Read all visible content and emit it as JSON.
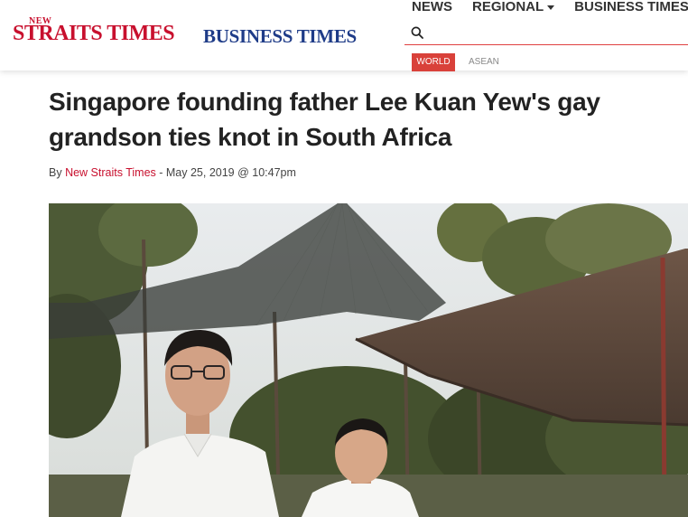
{
  "header": {
    "logo_new": "NEW",
    "logo_main": "STRAITS TIMES",
    "logo_business": "BUSINESS TIMES",
    "nav": [
      {
        "label": "NEWS",
        "has_dropdown": false
      },
      {
        "label": "REGIONAL",
        "has_dropdown": true
      },
      {
        "label": "BUSINESS TIMES",
        "has_dropdown": false
      }
    ],
    "search": {
      "value": "",
      "placeholder": "",
      "icon": "search-icon"
    },
    "tabs": [
      {
        "label": "WORLD",
        "active": true
      },
      {
        "label": "ASEAN",
        "active": false
      }
    ]
  },
  "article": {
    "headline": "Singapore founding father Lee Kuan Yew's gay grandson ties knot in South Africa",
    "byline": {
      "prefix": "By ",
      "author": "New Straits Times",
      "date": " - May 25, 2019 @ 10:47pm"
    }
  },
  "colors": {
    "brand_red": "#c8102e",
    "business_blue": "#1f3c88",
    "tab_active": "#d9413a"
  }
}
